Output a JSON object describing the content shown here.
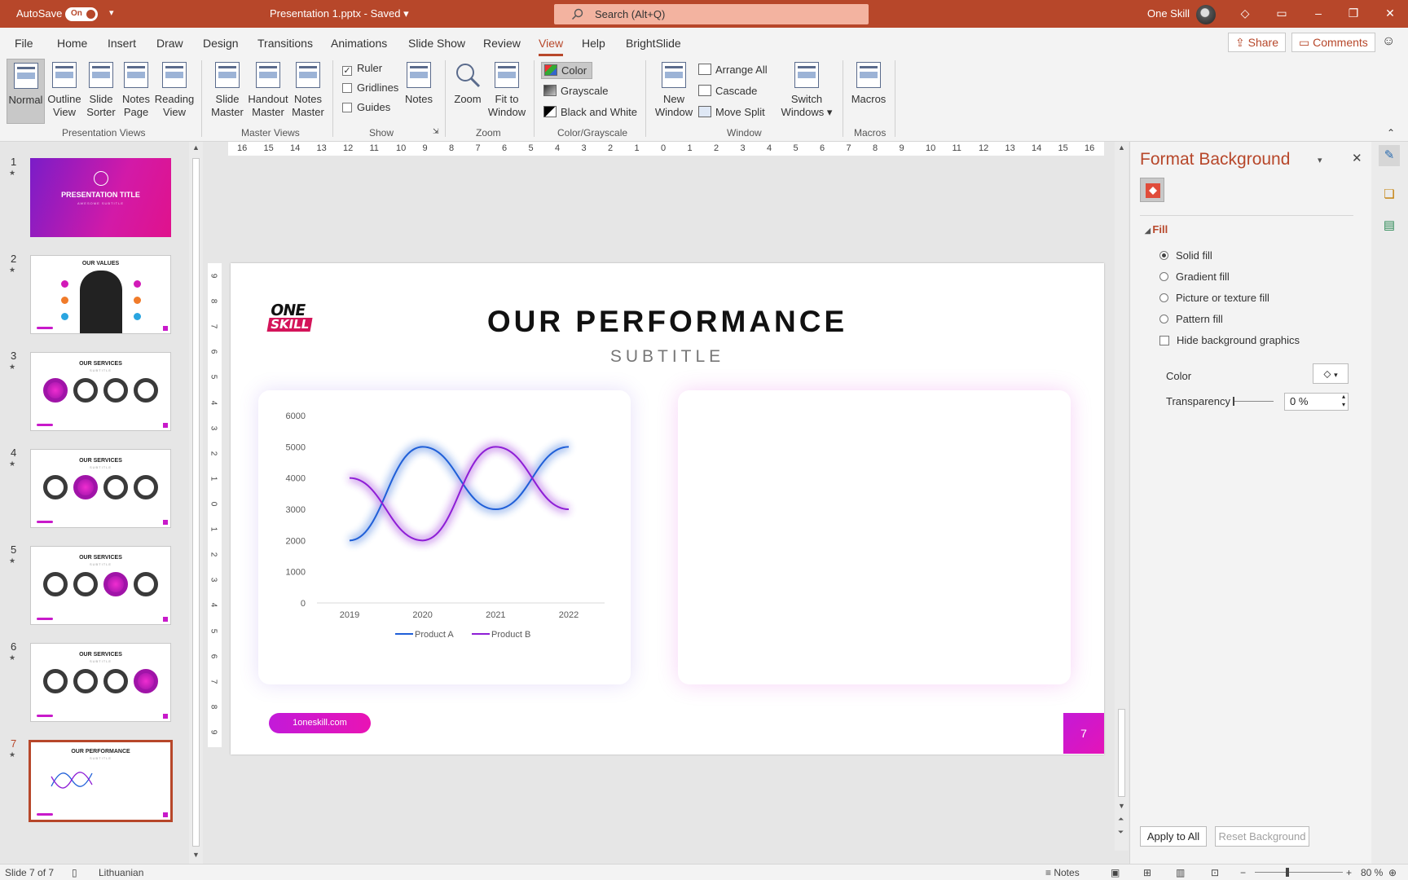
{
  "titlebar": {
    "autosave_label": "AutoSave",
    "autosave_state": "On",
    "doc_title": "Presentation 1.pptx",
    "saved_status": "Saved",
    "search_placeholder": "Search (Alt+Q)",
    "user_name": "One Skill"
  },
  "menu": {
    "tabs": [
      "File",
      "Home",
      "Insert",
      "Draw",
      "Design",
      "Transitions",
      "Animations",
      "Slide Show",
      "Review",
      "View",
      "Help",
      "BrightSlide"
    ],
    "active_tab": "View",
    "share_label": "Share",
    "comments_label": "Comments"
  },
  "ribbon": {
    "presentation_views": {
      "label": "Presentation Views",
      "normal": "Normal",
      "outline_1": "Outline",
      "outline_2": "View",
      "sorter_1": "Slide",
      "sorter_2": "Sorter",
      "notespage_1": "Notes",
      "notespage_2": "Page",
      "reading_1": "Reading",
      "reading_2": "View"
    },
    "master_views": {
      "label": "Master Views",
      "slide_1": "Slide",
      "slide_2": "Master",
      "handout_1": "Handout",
      "handout_2": "Master",
      "notes_1": "Notes",
      "notes_2": "Master"
    },
    "show": {
      "label": "Show",
      "ruler": "Ruler",
      "ruler_checked": true,
      "gridlines": "Gridlines",
      "guides": "Guides",
      "notes": "Notes"
    },
    "zoom": {
      "label": "Zoom",
      "zoom": "Zoom",
      "fit_1": "Fit to",
      "fit_2": "Window"
    },
    "color_grayscale": {
      "label": "Color/Grayscale",
      "color": "Color",
      "grayscale": "Grayscale",
      "bw": "Black and White"
    },
    "window": {
      "label": "Window",
      "new_1": "New",
      "new_2": "Window",
      "arrange_all": "Arrange All",
      "cascade": "Cascade",
      "move_split": "Move Split",
      "switch_1": "Switch",
      "switch_2": "Windows"
    },
    "macros": {
      "label": "Macros",
      "macros": "Macros"
    }
  },
  "thumbnails": [
    {
      "num": "1",
      "title": "PRESENTATION TITLE",
      "subtitle": "AWESOME SUBTITLE"
    },
    {
      "num": "2",
      "title": "OUR VALUES",
      "subtitle": "SUBTITLE"
    },
    {
      "num": "3",
      "title": "OUR SERVICES",
      "subtitle": "SUBTITLE"
    },
    {
      "num": "4",
      "title": "OUR SERVICES",
      "subtitle": "SUBTITLE"
    },
    {
      "num": "5",
      "title": "OUR SERVICES",
      "subtitle": "SUBTITLE"
    },
    {
      "num": "6",
      "title": "OUR SERVICES",
      "subtitle": "SUBTITLE"
    },
    {
      "num": "7",
      "title": "OUR PERFORMANCE",
      "subtitle": "SUBTITLE"
    }
  ],
  "current_slide": 7,
  "ruler_h_labels": [
    "16",
    "15",
    "14",
    "13",
    "12",
    "11",
    "10",
    "9",
    "8",
    "7",
    "6",
    "5",
    "4",
    "3",
    "2",
    "1",
    "0",
    "1",
    "2",
    "3",
    "4",
    "5",
    "6",
    "7",
    "8",
    "9",
    "10",
    "11",
    "12",
    "13",
    "14",
    "15",
    "16"
  ],
  "ruler_v_labels": [
    "9",
    "8",
    "7",
    "6",
    "5",
    "4",
    "3",
    "2",
    "1",
    "0",
    "1",
    "2",
    "3",
    "4",
    "5",
    "6",
    "7",
    "8",
    "9"
  ],
  "slide": {
    "logo_line1": "ONE",
    "logo_line2": "SKILL",
    "title": "OUR PERFORMANCE",
    "subtitle": "SUBTITLE",
    "link_pill": "1oneskill.com",
    "page_number": "7"
  },
  "chart_data": {
    "type": "line",
    "x": [
      "2019",
      "2020",
      "2021",
      "2022"
    ],
    "series": [
      {
        "name": "Product A",
        "values": [
          2000,
          5000,
          3000,
          5000
        ],
        "color": "#1f5fd8"
      },
      {
        "name": "Product B",
        "values": [
          4000,
          2000,
          5000,
          3000
        ],
        "color": "#8e1ed6"
      }
    ],
    "yticks": [
      "0",
      "1000",
      "2000",
      "3000",
      "4000",
      "5000",
      "6000"
    ],
    "ylim": [
      0,
      6000
    ],
    "smooth": true,
    "legend": "bottom",
    "grid": false
  },
  "format_pane": {
    "title": "Format Background",
    "section": "Fill",
    "options": [
      "Solid fill",
      "Gradient fill",
      "Picture or texture fill",
      "Pattern fill"
    ],
    "selected_option": "Solid fill",
    "hide_graphics": "Hide background graphics",
    "color_label": "Color",
    "transparency_label": "Transparency",
    "transparency_value": "0 %",
    "apply_all": "Apply to All",
    "reset": "Reset Background"
  },
  "status": {
    "slide_info": "Slide 7 of 7",
    "language": "Lithuanian",
    "notes": "Notes",
    "zoom": "80 %"
  }
}
